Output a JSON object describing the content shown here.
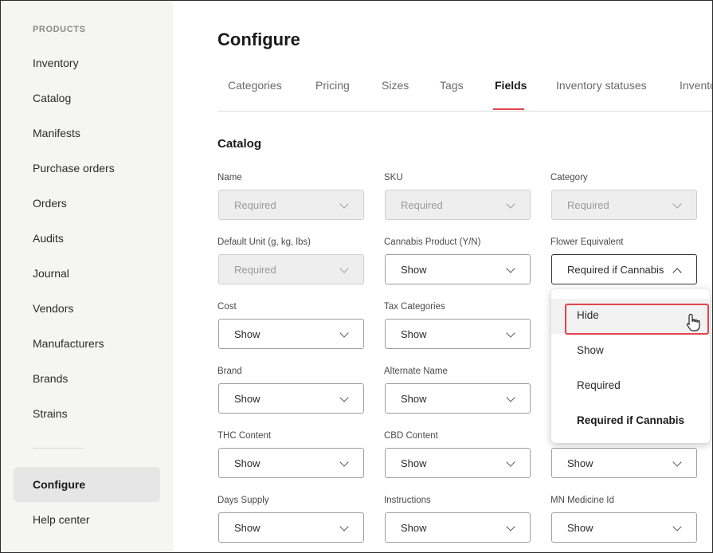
{
  "sidebar": {
    "section": "PRODUCTS",
    "items": [
      "Inventory",
      "Catalog",
      "Manifests",
      "Purchase orders",
      "Orders",
      "Audits",
      "Journal",
      "Vendors",
      "Manufacturers",
      "Brands",
      "Strains"
    ],
    "configure": "Configure",
    "help": "Help center"
  },
  "page": {
    "title": "Configure"
  },
  "tabs": [
    "Categories",
    "Pricing",
    "Sizes",
    "Tags",
    "Fields",
    "Inventory statuses",
    "Invento"
  ],
  "active_tab": "Fields",
  "section": "Catalog",
  "fields": {
    "name": {
      "label": "Name",
      "value": "Required"
    },
    "sku": {
      "label": "SKU",
      "value": "Required"
    },
    "category": {
      "label": "Category",
      "value": "Required"
    },
    "default_unit": {
      "label": "Default Unit (g, kg, lbs)",
      "value": "Required"
    },
    "cannabis_product": {
      "label": "Cannabis Product (Y/N)",
      "value": "Show"
    },
    "flower_equivalent": {
      "label": "Flower Equivalent",
      "value": "Required if Cannabis"
    },
    "cost": {
      "label": "Cost",
      "value": "Show"
    },
    "tax_categories": {
      "label": "Tax Categories",
      "value": "Show"
    },
    "brand": {
      "label": "Brand",
      "value": "Show"
    },
    "alternate_name": {
      "label": "Alternate Name",
      "value": "Show"
    },
    "thc_content": {
      "label": "THC Content",
      "value": "Show"
    },
    "cbd_content": {
      "label": "CBD Content",
      "value": "Show"
    },
    "hidden_col3_row5": {
      "value": "Show"
    },
    "days_supply": {
      "label": "Days Supply",
      "value": "Show"
    },
    "instructions": {
      "label": "Instructions",
      "value": "Show"
    },
    "mn_medicine_id": {
      "label": "MN Medicine Id",
      "value": "Show"
    }
  },
  "dropdown": {
    "options": [
      "Hide",
      "Show",
      "Required",
      "Required if Cannabis"
    ],
    "hovered": "Hide",
    "selected": "Required if Cannabis"
  },
  "colors": {
    "accent": "#e0464c",
    "sidebar_bg": "#f5f5f4"
  }
}
